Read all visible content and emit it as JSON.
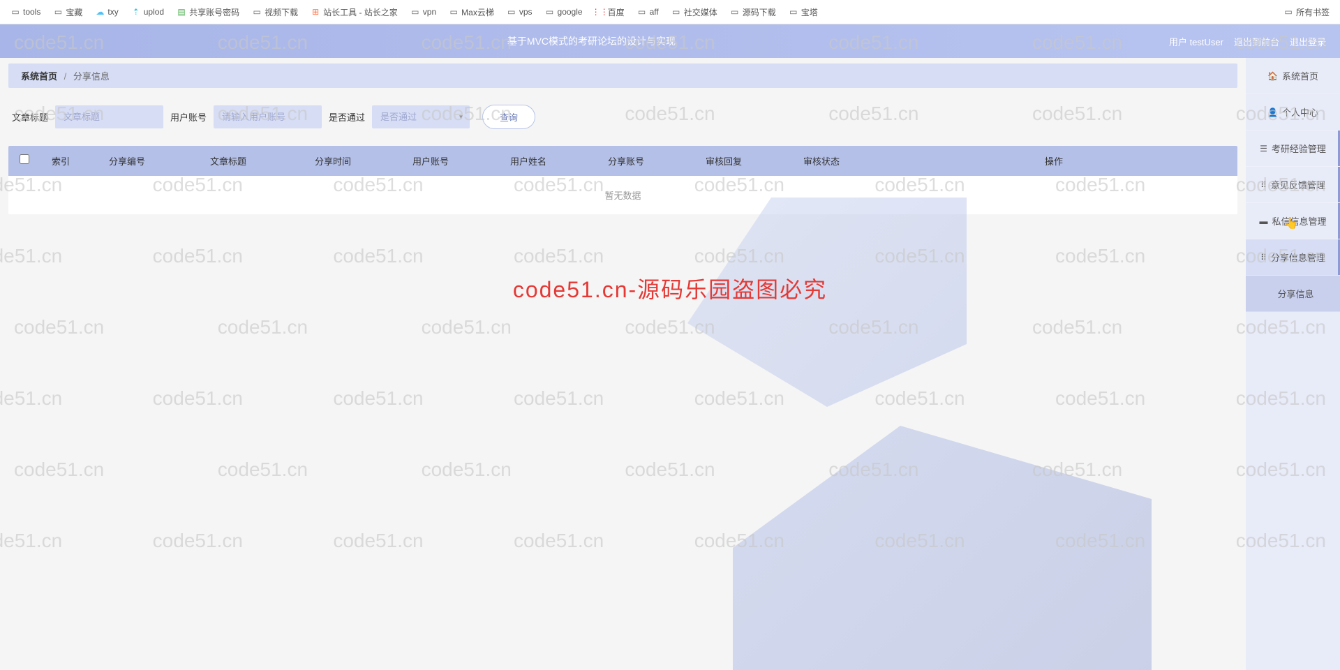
{
  "bookmarks": {
    "items": [
      {
        "label": "tools",
        "icon": "folder"
      },
      {
        "label": "宝藏",
        "icon": "folder"
      },
      {
        "label": "txy",
        "icon": "cloud"
      },
      {
        "label": "uplod",
        "icon": "upload"
      },
      {
        "label": "共享账号密码",
        "icon": "green"
      },
      {
        "label": "视频下载",
        "icon": "folder"
      },
      {
        "label": "站长工具 - 站长之家",
        "icon": "site"
      },
      {
        "label": "vpn",
        "icon": "folder"
      },
      {
        "label": "Max云梯",
        "icon": "folder"
      },
      {
        "label": "vps",
        "icon": "folder"
      },
      {
        "label": "google",
        "icon": "folder"
      },
      {
        "label": "百度",
        "icon": "baidu"
      },
      {
        "label": "aff",
        "icon": "folder"
      },
      {
        "label": "社交媒体",
        "icon": "folder"
      },
      {
        "label": "源码下载",
        "icon": "folder"
      },
      {
        "label": "宝塔",
        "icon": "folder"
      }
    ],
    "right": {
      "label": "所有书签",
      "icon": "folder"
    }
  },
  "header": {
    "title": "基于MVC模式的考研论坛的设计与实现",
    "user_label": "用户 testUser",
    "back_label": "退出到前台",
    "logout_label": "退出登录"
  },
  "breadcrumb": {
    "home": "系统首页",
    "current": "分享信息"
  },
  "search": {
    "title_label": "文章标题",
    "title_placeholder": "文章标题",
    "user_label": "用户账号",
    "user_placeholder": "请输入用户账号",
    "pass_label": "是否通过",
    "pass_placeholder": "是否通过",
    "query_btn": "查询"
  },
  "table": {
    "headers": {
      "index": "索引",
      "share_id": "分享编号",
      "title": "文章标题",
      "time": "分享时间",
      "user_acc": "用户账号",
      "user_name": "用户姓名",
      "share_acc": "分享账号",
      "reply": "审核回复",
      "status": "审核状态",
      "action": "操作"
    },
    "empty": "暂无数据"
  },
  "sidebar": {
    "items": [
      {
        "label": "系统首页",
        "icon": "🏠"
      },
      {
        "label": "个人中心",
        "icon": "👤"
      },
      {
        "label": "考研经验管理",
        "icon": "☰"
      },
      {
        "label": "意见反馈管理",
        "icon": "⠿"
      },
      {
        "label": "私信信息管理",
        "icon": "▬"
      },
      {
        "label": "分享信息管理",
        "icon": "⠿"
      }
    ],
    "sub": "分享信息"
  },
  "watermark": {
    "text": "code51.cn",
    "center": "code51.cn-源码乐园盗图必究"
  }
}
